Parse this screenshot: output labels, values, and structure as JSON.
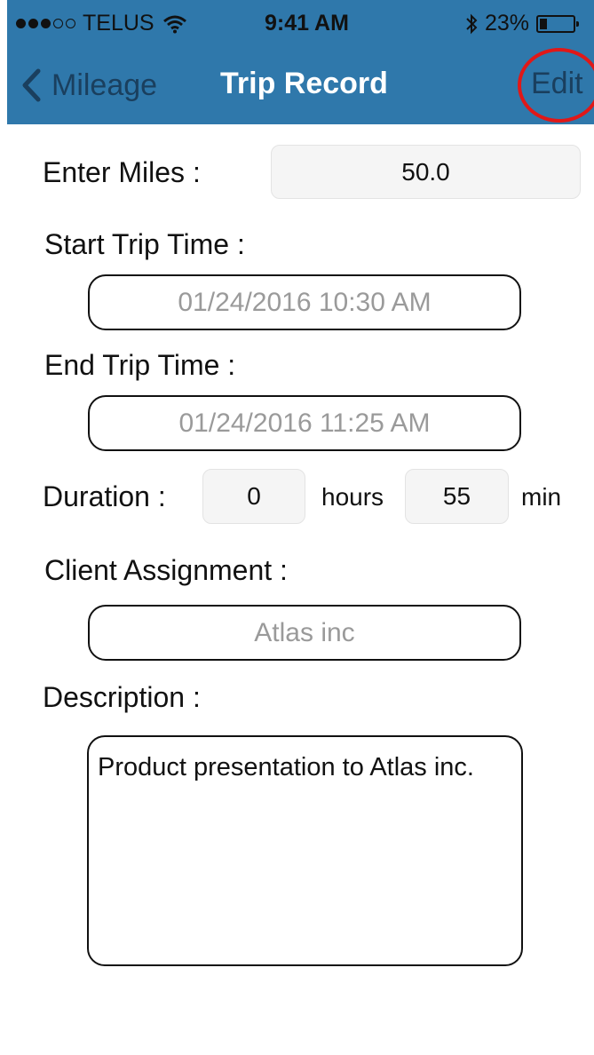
{
  "status_bar": {
    "carrier": "TELUS",
    "time": "9:41 AM",
    "battery": "23%",
    "battery_level": 0.23,
    "icons": [
      "signal-dots-icon",
      "wifi-icon",
      "bluetooth-icon",
      "battery-icon"
    ]
  },
  "nav": {
    "back_label": "Mileage",
    "title": "Trip Record",
    "edit_label": "Edit",
    "color": "#2f78ab",
    "highlight_color": "#e01818"
  },
  "form": {
    "miles_label": "Enter Miles :",
    "miles_value": "50.0",
    "start_label": "Start Trip Time :",
    "start_value": "01/24/2016 10:30 AM",
    "end_label": "End Trip Time :",
    "end_value": "01/24/2016 11:25 AM",
    "duration_label": "Duration :",
    "hours_value": "0",
    "hours_unit": "hours",
    "minutes_value": "55",
    "minutes_unit": "min",
    "client_label": "Client Assignment :",
    "client_value": "Atlas inc",
    "description_label": "Description :",
    "description_value": "Product presentation to Atlas inc."
  }
}
